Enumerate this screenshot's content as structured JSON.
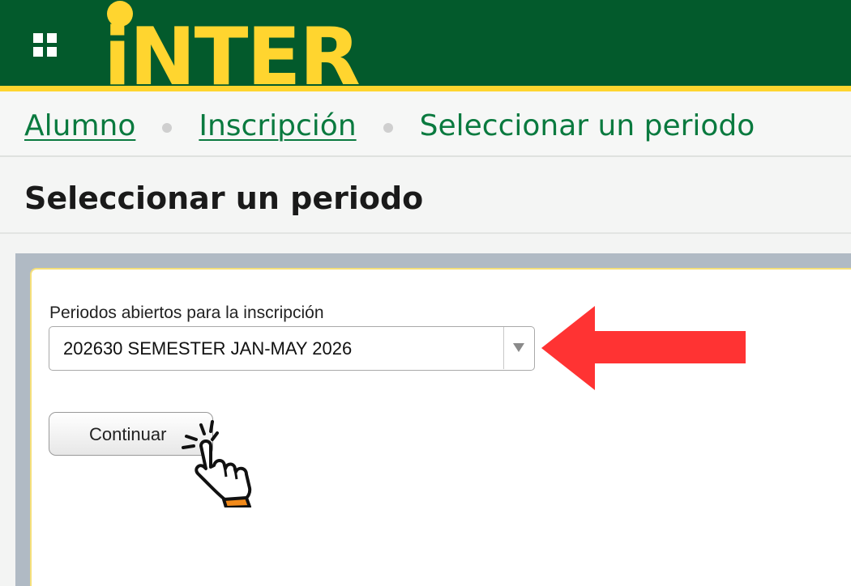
{
  "header": {
    "logo_text": "iNTER",
    "menu_icon": "grid-menu-icon",
    "colors": {
      "background": "#035a2c",
      "accent": "#ffd52f"
    }
  },
  "breadcrumb": {
    "items": [
      {
        "label": "Alumno",
        "link": true
      },
      {
        "label": "Inscripción",
        "link": true
      },
      {
        "label": "Seleccionar un periodo",
        "link": false
      }
    ],
    "color": "#0a7a3f"
  },
  "page": {
    "title": "Seleccionar un periodo"
  },
  "form": {
    "select_label": "Periodos abiertos para la inscripción",
    "select_value": "202630 SEMESTER JAN-MAY 2026",
    "continue_label": "Continuar"
  },
  "annotations": {
    "arrow_icon": "red-left-arrow-icon",
    "arrow_color": "#ff3333",
    "cursor_icon": "hand-pointer-click-icon"
  }
}
